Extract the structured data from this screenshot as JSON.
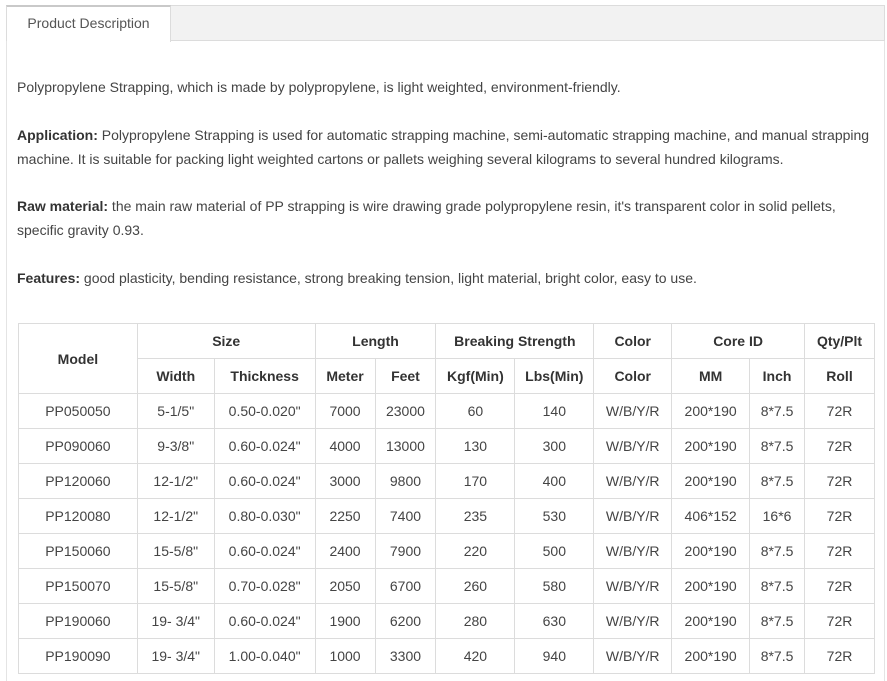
{
  "tabs": [
    {
      "label": "Product Description"
    }
  ],
  "description": {
    "intro": "Polypropylene Strapping, which is made by polypropylene, is light weighted, environment-friendly.",
    "application_label": "Application:",
    "application_text": " Polypropylene Strapping is used for automatic strapping machine, semi-automatic strapping machine, and manual strapping machine. It is suitable for packing light weighted cartons or pallets weighing several kilograms to several hundred kilograms.",
    "raw_material_label": "Raw material:",
    "raw_material_text": " the main raw material of PP strapping is wire drawing grade polypropylene resin, it's transparent color in solid pellets, specific gravity 0.93.",
    "features_label": "Features:",
    "features_text": " good plasticity, bending resistance, strong breaking tension, light material, bright color, easy to use."
  },
  "table": {
    "group_headers": {
      "model": "Model",
      "size": "Size",
      "length": "Length",
      "breaking_strength": "Breaking Strength",
      "color": "Color",
      "core_id": "Core ID",
      "qty": "Qty/Plt"
    },
    "sub_headers": {
      "width": "Width",
      "thickness": "Thickness",
      "meter": "Meter",
      "feet": "Feet",
      "kgf": "Kgf(Min)",
      "lbs": "Lbs(Min)",
      "color": "Color",
      "mm": "MM",
      "inch": "Inch",
      "roll": "Roll"
    },
    "rows": [
      [
        "PP050050",
        "5-1/5\"",
        "0.50-0.020\"",
        "7000",
        "23000",
        "60",
        "140",
        "W/B/Y/R",
        "200*190",
        "8*7.5",
        "72R"
      ],
      [
        "PP090060",
        "9-3/8\"",
        "0.60-0.024\"",
        "4000",
        "13000",
        "130",
        "300",
        "W/B/Y/R",
        "200*190",
        "8*7.5",
        "72R"
      ],
      [
        "PP120060",
        "12-1/2\"",
        "0.60-0.024\"",
        "3000",
        "9800",
        "170",
        "400",
        "W/B/Y/R",
        "200*190",
        "8*7.5",
        "72R"
      ],
      [
        "PP120080",
        "12-1/2\"",
        "0.80-0.030\"",
        "2250",
        "7400",
        "235",
        "530",
        "W/B/Y/R",
        "406*152",
        "16*6",
        "72R"
      ],
      [
        "PP150060",
        "15-5/8\"",
        "0.60-0.024\"",
        "2400",
        "7900",
        "220",
        "500",
        "W/B/Y/R",
        "200*190",
        "8*7.5",
        "72R"
      ],
      [
        "PP150070",
        "15-5/8\"",
        "0.70-0.028\"",
        "2050",
        "6700",
        "260",
        "580",
        "W/B/Y/R",
        "200*190",
        "8*7.5",
        "72R"
      ],
      [
        "PP190060",
        "19- 3/4\"",
        "0.60-0.024\"",
        "1900",
        "6200",
        "280",
        "630",
        "W/B/Y/R",
        "200*190",
        "8*7.5",
        "72R"
      ],
      [
        "PP190090",
        "19- 3/4\"",
        "1.00-0.040\"",
        "1000",
        "3300",
        "420",
        "940",
        "W/B/Y/R",
        "200*190",
        "8*7.5",
        "72R"
      ]
    ]
  }
}
